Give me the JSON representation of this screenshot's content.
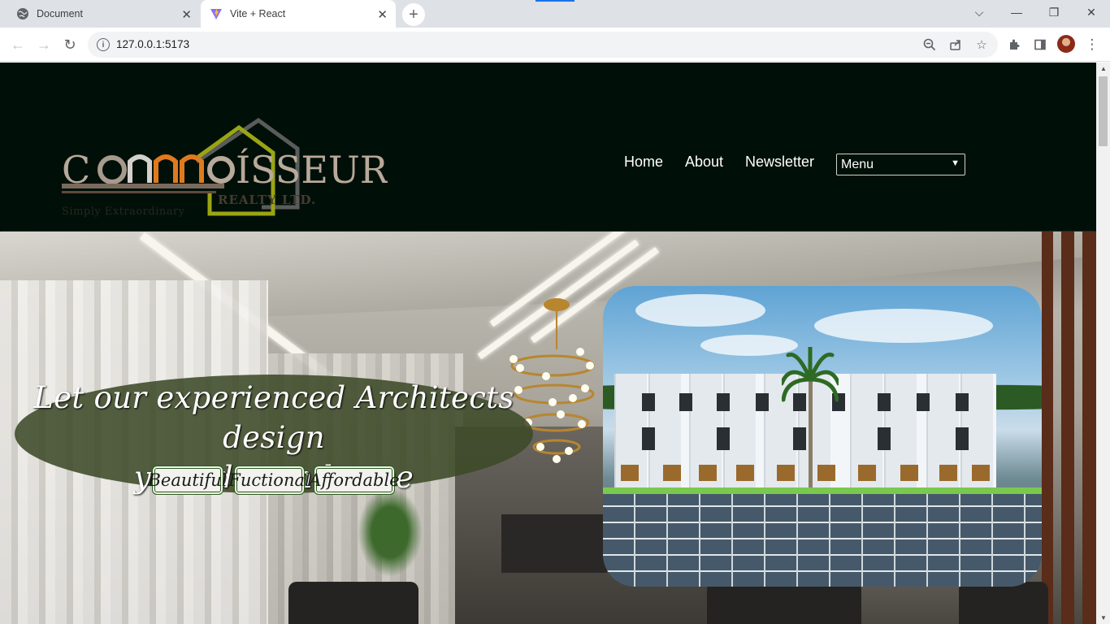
{
  "browser": {
    "tabs": [
      {
        "title": "Document",
        "active": false,
        "favicon": "globe-icon"
      },
      {
        "title": "Vite + React",
        "active": true,
        "favicon": "vite-logo-icon"
      }
    ],
    "address": "127.0.0.1:5173",
    "icons": [
      "back-arrow-icon",
      "forward-arrow-icon",
      "reload-icon",
      "site-info-icon",
      "zoom-out-icon",
      "share-icon",
      "star-icon",
      "extensions-icon",
      "side-panel-icon",
      "profile-avatar",
      "more-menu-icon"
    ]
  },
  "site": {
    "logo": {
      "wordmark": "CONNOISSEUR",
      "subtitle": "REALTY LTD.",
      "slogan": "Simply Extraordinary"
    },
    "nav": {
      "home": "Home",
      "about": "About",
      "newsletter": "Newsletter",
      "menu_selected": "Menu"
    },
    "hero": {
      "headline_line1": "Let our experienced Architects design",
      "headline_line2": "your dream house",
      "badges": [
        "Beautiful",
        "Fuctional",
        "Affordable"
      ]
    }
  },
  "colors": {
    "header_bg": "#001008",
    "tagline_bg": "#3c4a28",
    "badge_border": "#2d5a1e",
    "logo_orange": "#e07a1e",
    "logo_green": "#9aa514"
  }
}
